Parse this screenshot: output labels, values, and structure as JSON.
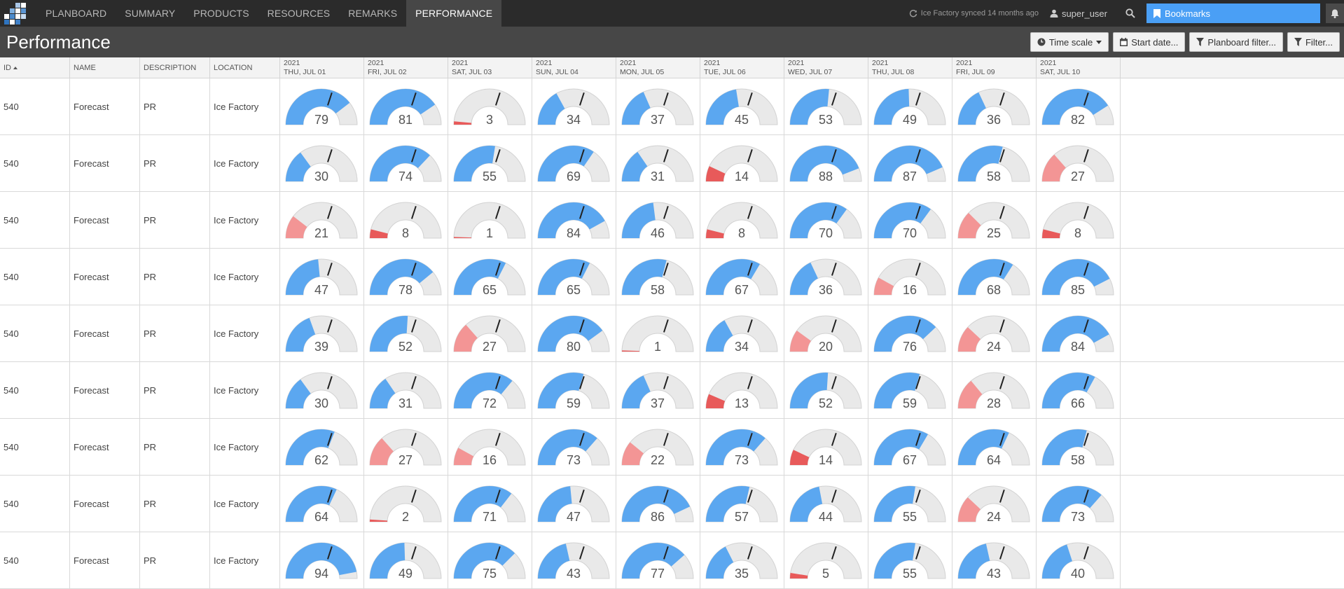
{
  "nav": {
    "items": [
      "PLANBOARD",
      "SUMMARY",
      "PRODUCTS",
      "RESOURCES",
      "REMARKS",
      "PERFORMANCE"
    ],
    "active": "PERFORMANCE",
    "sync_text": "Ice Factory synced 14 months ago",
    "user": "super_user",
    "bookmarks": "Bookmarks"
  },
  "header": {
    "title": "Performance",
    "buttons": {
      "time_scale": "Time scale",
      "start_date": "Start date...",
      "planboard_filter": "Planboard filter...",
      "filter": "Filter..."
    }
  },
  "table": {
    "columns": {
      "id": "ID",
      "name": "NAME",
      "description": "DESCRIPTION",
      "location": "LOCATION"
    },
    "dates": [
      {
        "year": "2021",
        "day": "THU, JUL 01"
      },
      {
        "year": "2021",
        "day": "FRI, JUL 02"
      },
      {
        "year": "2021",
        "day": "SAT, JUL 03"
      },
      {
        "year": "2021",
        "day": "SUN, JUL 04"
      },
      {
        "year": "2021",
        "day": "MON, JUL 05"
      },
      {
        "year": "2021",
        "day": "TUE, JUL 06"
      },
      {
        "year": "2021",
        "day": "WED, JUL 07"
      },
      {
        "year": "2021",
        "day": "THU, JUL 08"
      },
      {
        "year": "2021",
        "day": "FRI, JUL 09"
      },
      {
        "year": "2021",
        "day": "SAT, JUL 10"
      }
    ],
    "rows": [
      {
        "id": "540",
        "name": "Forecast",
        "description": "PR",
        "location": "Ice Factory",
        "values": [
          79,
          81,
          3,
          34,
          37,
          45,
          53,
          49,
          36,
          82
        ]
      },
      {
        "id": "540",
        "name": "Forecast",
        "description": "PR",
        "location": "Ice Factory",
        "values": [
          30,
          74,
          55,
          69,
          31,
          14,
          88,
          87,
          58,
          27
        ]
      },
      {
        "id": "540",
        "name": "Forecast",
        "description": "PR",
        "location": "Ice Factory",
        "values": [
          21,
          8,
          1,
          84,
          46,
          8,
          70,
          70,
          25,
          8
        ]
      },
      {
        "id": "540",
        "name": "Forecast",
        "description": "PR",
        "location": "Ice Factory",
        "values": [
          47,
          78,
          65,
          65,
          58,
          67,
          36,
          16,
          68,
          85
        ]
      },
      {
        "id": "540",
        "name": "Forecast",
        "description": "PR",
        "location": "Ice Factory",
        "values": [
          39,
          52,
          27,
          80,
          1,
          34,
          20,
          76,
          24,
          84
        ]
      },
      {
        "id": "540",
        "name": "Forecast",
        "description": "PR",
        "location": "Ice Factory",
        "values": [
          30,
          31,
          72,
          59,
          37,
          13,
          52,
          59,
          28,
          66
        ]
      },
      {
        "id": "540",
        "name": "Forecast",
        "description": "PR",
        "location": "Ice Factory",
        "values": [
          62,
          27,
          16,
          73,
          22,
          73,
          14,
          67,
          64,
          58
        ]
      },
      {
        "id": "540",
        "name": "Forecast",
        "description": "PR",
        "location": "Ice Factory",
        "values": [
          64,
          2,
          71,
          47,
          86,
          57,
          44,
          55,
          24,
          73
        ]
      },
      {
        "id": "540",
        "name": "Forecast",
        "description": "PR",
        "location": "Ice Factory",
        "values": [
          94,
          49,
          75,
          43,
          77,
          35,
          5,
          55,
          43,
          40
        ]
      }
    ]
  },
  "gauge": {
    "max": 100,
    "target": 60,
    "colors": {
      "good": "#5ba7f0",
      "warn_light": "#f39595",
      "warn_dark": "#e85a5a",
      "track": "#e9e9e9",
      "needle": "#222222"
    }
  }
}
